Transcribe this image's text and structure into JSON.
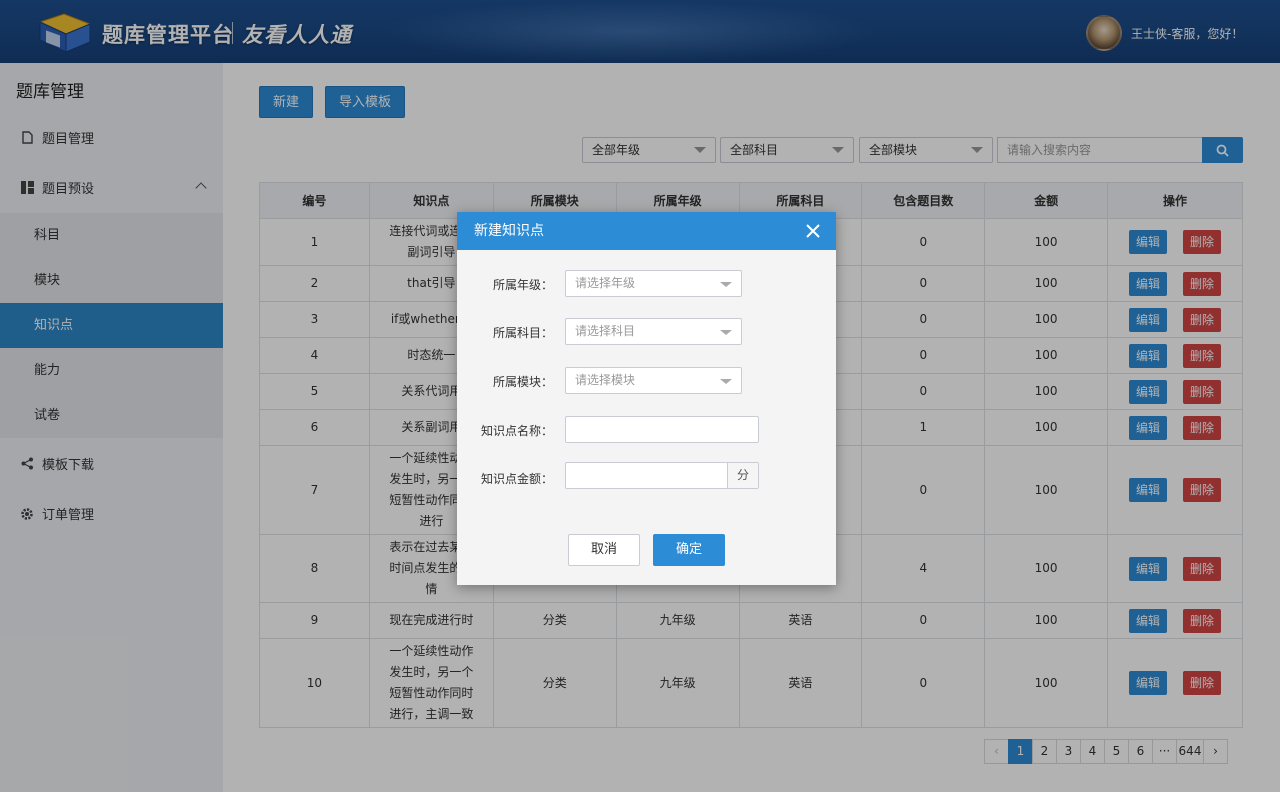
{
  "header": {
    "logo_text": "题库管理平台",
    "slogan": "友看人人通",
    "user_greeting": "王士侠-客服，您好！"
  },
  "sidebar": {
    "title": "题库管理",
    "items": [
      {
        "label": "题目管理",
        "icon": "document-icon"
      },
      {
        "label": "题目预设",
        "icon": "grid-icon"
      },
      {
        "label": "模板下载",
        "icon": "share-icon"
      },
      {
        "label": "订单管理",
        "icon": "gear-icon"
      }
    ],
    "sub_items": [
      "科目",
      "模块",
      "知识点",
      "能力",
      "试卷"
    ],
    "active_sub": "知识点"
  },
  "toolbar": {
    "new_label": "新建",
    "import_label": "导入模板"
  },
  "filters": {
    "grade": "全部年级",
    "subject": "全部科目",
    "module": "全部模块",
    "search_placeholder": "请输入搜索内容"
  },
  "table": {
    "headers": [
      "编号",
      "知识点",
      "所属模块",
      "所属年级",
      "所属科目",
      "包含题目数",
      "金额",
      "操作"
    ],
    "edit_label": "编辑",
    "delete_label": "删除",
    "rows": [
      {
        "id": "1",
        "kp": "连接代词或连接副词引导",
        "module": "",
        "grade": "",
        "subject": "",
        "count": "0",
        "amount": "100"
      },
      {
        "id": "2",
        "kp": "that引导",
        "module": "",
        "grade": "",
        "subject": "",
        "count": "0",
        "amount": "100"
      },
      {
        "id": "3",
        "kp": "if或whether引",
        "module": "",
        "grade": "",
        "subject": "",
        "count": "0",
        "amount": "100"
      },
      {
        "id": "4",
        "kp": "时态统一",
        "module": "",
        "grade": "",
        "subject": "",
        "count": "0",
        "amount": "100"
      },
      {
        "id": "5",
        "kp": "关系代词用",
        "module": "",
        "grade": "",
        "subject": "",
        "count": "0",
        "amount": "100"
      },
      {
        "id": "6",
        "kp": "关系副词用",
        "module": "",
        "grade": "",
        "subject": "",
        "count": "1",
        "amount": "100"
      },
      {
        "id": "7",
        "kp": "一个延续性动作发生时，另一个短暂性动作同时进行",
        "module": "",
        "grade": "",
        "subject": "",
        "count": "0",
        "amount": "100"
      },
      {
        "id": "8",
        "kp": "表示在过去某一时间点发生的事情",
        "module": "",
        "grade": "",
        "subject": "",
        "count": "4",
        "amount": "100"
      },
      {
        "id": "9",
        "kp": "现在完成进行时",
        "module": "分类",
        "grade": "九年级",
        "subject": "英语",
        "count": "0",
        "amount": "100"
      },
      {
        "id": "10",
        "kp": "一个延续性动作发生时，另一个短暂性动作同时进行，主调一致",
        "module": "分类",
        "grade": "九年级",
        "subject": "英语",
        "count": "0",
        "amount": "100"
      }
    ]
  },
  "pagination": {
    "pages": [
      "1",
      "2",
      "3",
      "4",
      "5",
      "6",
      "···",
      "644"
    ],
    "current": "1",
    "prev": "‹",
    "next": "›"
  },
  "modal": {
    "title": "新建知识点",
    "grade_label": "所属年级：",
    "grade_placeholder": "请选择年级",
    "subject_label": "所属科目：",
    "subject_placeholder": "请选择科目",
    "module_label": "所属模块：",
    "module_placeholder": "请选择模块",
    "name_label": "知识点名称：",
    "name_value": "",
    "amount_label": "知识点金额：",
    "amount_value": "",
    "amount_unit": "分",
    "cancel_label": "取消",
    "ok_label": "确定"
  },
  "colors": {
    "primary": "#2d8cd6",
    "danger": "#d24646",
    "header_bg": "#1a4a86",
    "sidebar_active": "#2d87c8"
  }
}
